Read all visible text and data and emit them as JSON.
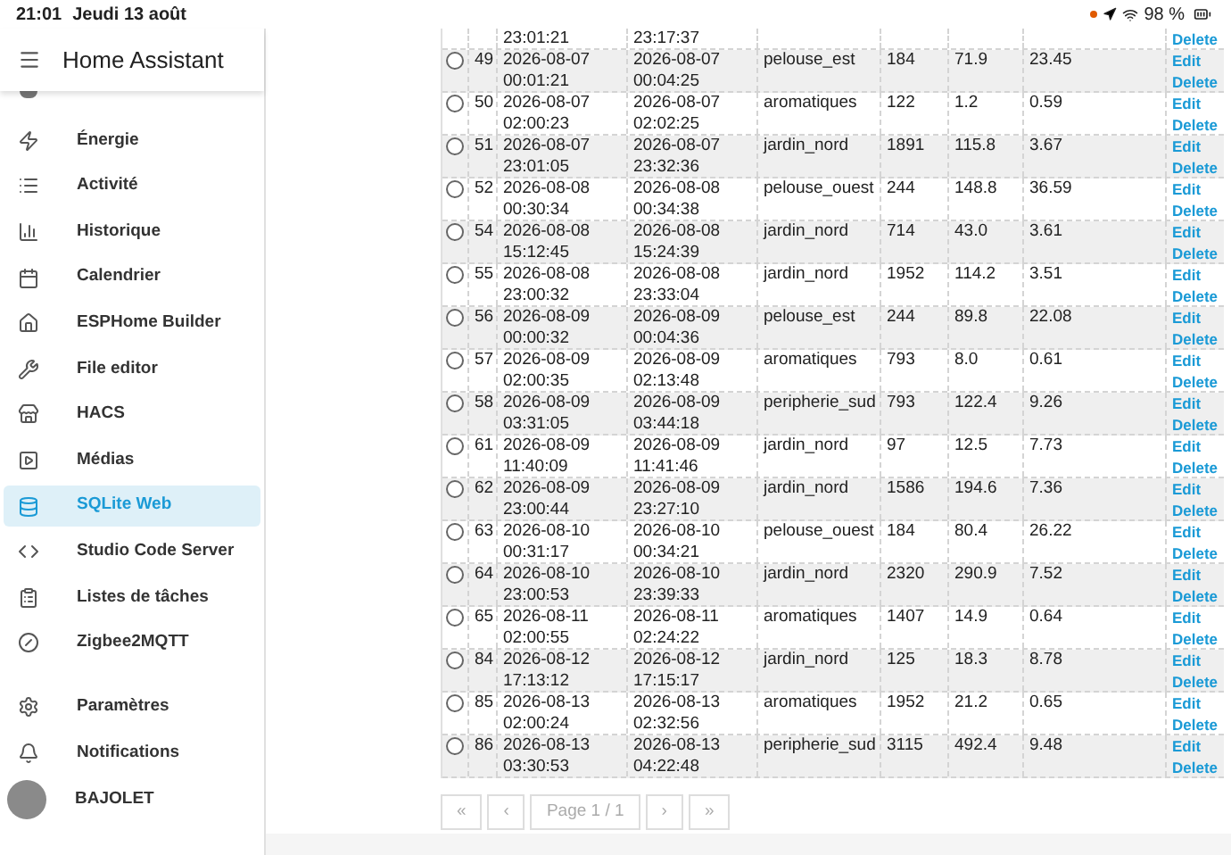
{
  "status_bar": {
    "time": "21:01",
    "date": "Jeudi 13 août",
    "battery": "98 %"
  },
  "sidebar": {
    "title": "Home Assistant",
    "items": [
      {
        "label": "Énergie",
        "selected": false
      },
      {
        "label": "Activité",
        "selected": false
      },
      {
        "label": "Historique",
        "selected": false
      },
      {
        "label": "Calendrier",
        "selected": false
      },
      {
        "label": "ESPHome Builder",
        "selected": false
      },
      {
        "label": "File editor",
        "selected": false
      },
      {
        "label": "HACS",
        "selected": false
      },
      {
        "label": "Médias",
        "selected": false
      },
      {
        "label": "SQLite Web",
        "selected": true
      },
      {
        "label": "Studio Code Server",
        "selected": false
      },
      {
        "label": "Listes de tâches",
        "selected": false
      },
      {
        "label": "Zigbee2MQTT",
        "selected": false
      }
    ],
    "bottom_items": [
      {
        "label": "Paramètres"
      },
      {
        "label": "Notifications"
      }
    ],
    "user": {
      "name": "BAJOLET"
    }
  },
  "table": {
    "rows": [
      {
        "kind": "partial",
        "start": [
          "23:01:21"
        ],
        "end": [
          "23:17:37"
        ],
        "actions": [
          "Delete"
        ]
      },
      {
        "kind": "full",
        "checked": false,
        "id": "49",
        "start": [
          "2026-08-07",
          "00:01:21"
        ],
        "end": [
          "2026-08-07",
          "00:04:25"
        ],
        "zone": "pelouse_est",
        "column_5": "184",
        "column_6": "71.9",
        "column_7": "23.45",
        "actions": [
          "Edit",
          "Delete"
        ]
      },
      {
        "kind": "full",
        "checked": false,
        "id": "50",
        "start": [
          "2026-08-07",
          "02:00:23"
        ],
        "end": [
          "2026-08-07",
          "02:02:25"
        ],
        "zone": "aromatiques",
        "column_5": "122",
        "column_6": "1.2",
        "column_7": "0.59",
        "actions": [
          "Edit",
          "Delete"
        ]
      },
      {
        "kind": "full",
        "checked": false,
        "id": "51",
        "start": [
          "2026-08-07",
          "23:01:05"
        ],
        "end": [
          "2026-08-07",
          "23:32:36"
        ],
        "zone": "jardin_nord",
        "column_5": "1891",
        "column_6": "115.8",
        "column_7": "3.67",
        "actions": [
          "Edit",
          "Delete"
        ]
      },
      {
        "kind": "full",
        "checked": false,
        "id": "52",
        "start": [
          "2026-08-08",
          "00:30:34"
        ],
        "end": [
          "2026-08-08",
          "00:34:38"
        ],
        "zone": "pelouse_ouest",
        "column_5": "244",
        "column_6": "148.8",
        "column_7": "36.59",
        "actions": [
          "Edit",
          "Delete"
        ]
      },
      {
        "kind": "full",
        "checked": false,
        "id": "54",
        "start": [
          "2026-08-08",
          "15:12:45"
        ],
        "end": [
          "2026-08-08",
          "15:24:39"
        ],
        "zone": "jardin_nord",
        "column_5": "714",
        "column_6": "43.0",
        "column_7": "3.61",
        "actions": [
          "Edit",
          "Delete"
        ]
      },
      {
        "kind": "full",
        "checked": false,
        "id": "55",
        "start": [
          "2026-08-08",
          "23:00:32"
        ],
        "end": [
          "2026-08-08",
          "23:33:04"
        ],
        "zone": "jardin_nord",
        "column_5": "1952",
        "column_6": "114.2",
        "column_7": "3.51",
        "actions": [
          "Edit",
          "Delete"
        ]
      },
      {
        "kind": "full",
        "checked": false,
        "id": "56",
        "start": [
          "2026-08-09",
          "00:00:32"
        ],
        "end": [
          "2026-08-09",
          "00:04:36"
        ],
        "zone": "pelouse_est",
        "column_5": "244",
        "column_6": "89.8",
        "column_7": "22.08",
        "actions": [
          "Edit",
          "Delete"
        ]
      },
      {
        "kind": "full",
        "checked": false,
        "id": "57",
        "start": [
          "2026-08-09",
          "02:00:35"
        ],
        "end": [
          "2026-08-09",
          "02:13:48"
        ],
        "zone": "aromatiques",
        "column_5": "793",
        "column_6": "8.0",
        "column_7": "0.61",
        "actions": [
          "Edit",
          "Delete"
        ]
      },
      {
        "kind": "full",
        "checked": false,
        "id": "58",
        "start": [
          "2026-08-09",
          "03:31:05"
        ],
        "end": [
          "2026-08-09",
          "03:44:18"
        ],
        "zone": "peripherie_sud",
        "column_5": "793",
        "column_6": "122.4",
        "column_7": "9.26",
        "actions": [
          "Edit",
          "Delete"
        ]
      },
      {
        "kind": "full",
        "checked": false,
        "id": "61",
        "start": [
          "2026-08-09",
          "11:40:09"
        ],
        "end": [
          "2026-08-09",
          "11:41:46"
        ],
        "zone": "jardin_nord",
        "column_5": "97",
        "column_6": "12.5",
        "column_7": "7.73",
        "actions": [
          "Edit",
          "Delete"
        ]
      },
      {
        "kind": "full",
        "checked": false,
        "id": "62",
        "start": [
          "2026-08-09",
          "23:00:44"
        ],
        "end": [
          "2026-08-09",
          "23:27:10"
        ],
        "zone": "jardin_nord",
        "column_5": "1586",
        "column_6": "194.6",
        "column_7": "7.36",
        "actions": [
          "Edit",
          "Delete"
        ]
      },
      {
        "kind": "full",
        "checked": false,
        "id": "63",
        "start": [
          "2026-08-10",
          "00:31:17"
        ],
        "end": [
          "2026-08-10",
          "00:34:21"
        ],
        "zone": "pelouse_ouest",
        "column_5": "184",
        "column_6": "80.4",
        "column_7": "26.22",
        "actions": [
          "Edit",
          "Delete"
        ]
      },
      {
        "kind": "full",
        "checked": false,
        "id": "64",
        "start": [
          "2026-08-10",
          "23:00:53"
        ],
        "end": [
          "2026-08-10",
          "23:39:33"
        ],
        "zone": "jardin_nord",
        "column_5": "2320",
        "column_6": "290.9",
        "column_7": "7.52",
        "actions": [
          "Edit",
          "Delete"
        ]
      },
      {
        "kind": "full",
        "checked": false,
        "id": "65",
        "start": [
          "2026-08-11",
          "02:00:55"
        ],
        "end": [
          "2026-08-11",
          "02:24:22"
        ],
        "zone": "aromatiques",
        "column_5": "1407",
        "column_6": "14.9",
        "column_7": "0.64",
        "actions": [
          "Edit",
          "Delete"
        ]
      },
      {
        "kind": "full",
        "checked": false,
        "id": "84",
        "start": [
          "2026-08-12",
          "17:13:12"
        ],
        "end": [
          "2026-08-12",
          "17:15:17"
        ],
        "zone": "jardin_nord",
        "column_5": "125",
        "column_6": "18.3",
        "column_7": "8.78",
        "actions": [
          "Edit",
          "Delete"
        ]
      },
      {
        "kind": "full",
        "checked": false,
        "id": "85",
        "start": [
          "2026-08-13",
          "02:00:24"
        ],
        "end": [
          "2026-08-13",
          "02:32:56"
        ],
        "zone": "aromatiques",
        "column_5": "1952",
        "column_6": "21.2",
        "column_7": "0.65",
        "actions": [
          "Edit",
          "Delete"
        ]
      },
      {
        "kind": "full",
        "checked": false,
        "id": "86",
        "start": [
          "2026-08-13",
          "03:30:53"
        ],
        "end": [
          "2026-08-13",
          "04:22:48"
        ],
        "zone": "peripherie_sud",
        "column_5": "3115",
        "column_6": "492.4",
        "column_7": "9.48",
        "actions": [
          "Edit",
          "Delete"
        ]
      }
    ]
  },
  "pagination": [
    {
      "label": "«",
      "disabled": true
    },
    {
      "label": "‹",
      "disabled": true
    },
    {
      "label": "Page 1 / 1",
      "disabled": true
    },
    {
      "label": "›",
      "disabled": true
    },
    {
      "label": "»",
      "disabled": true
    }
  ]
}
